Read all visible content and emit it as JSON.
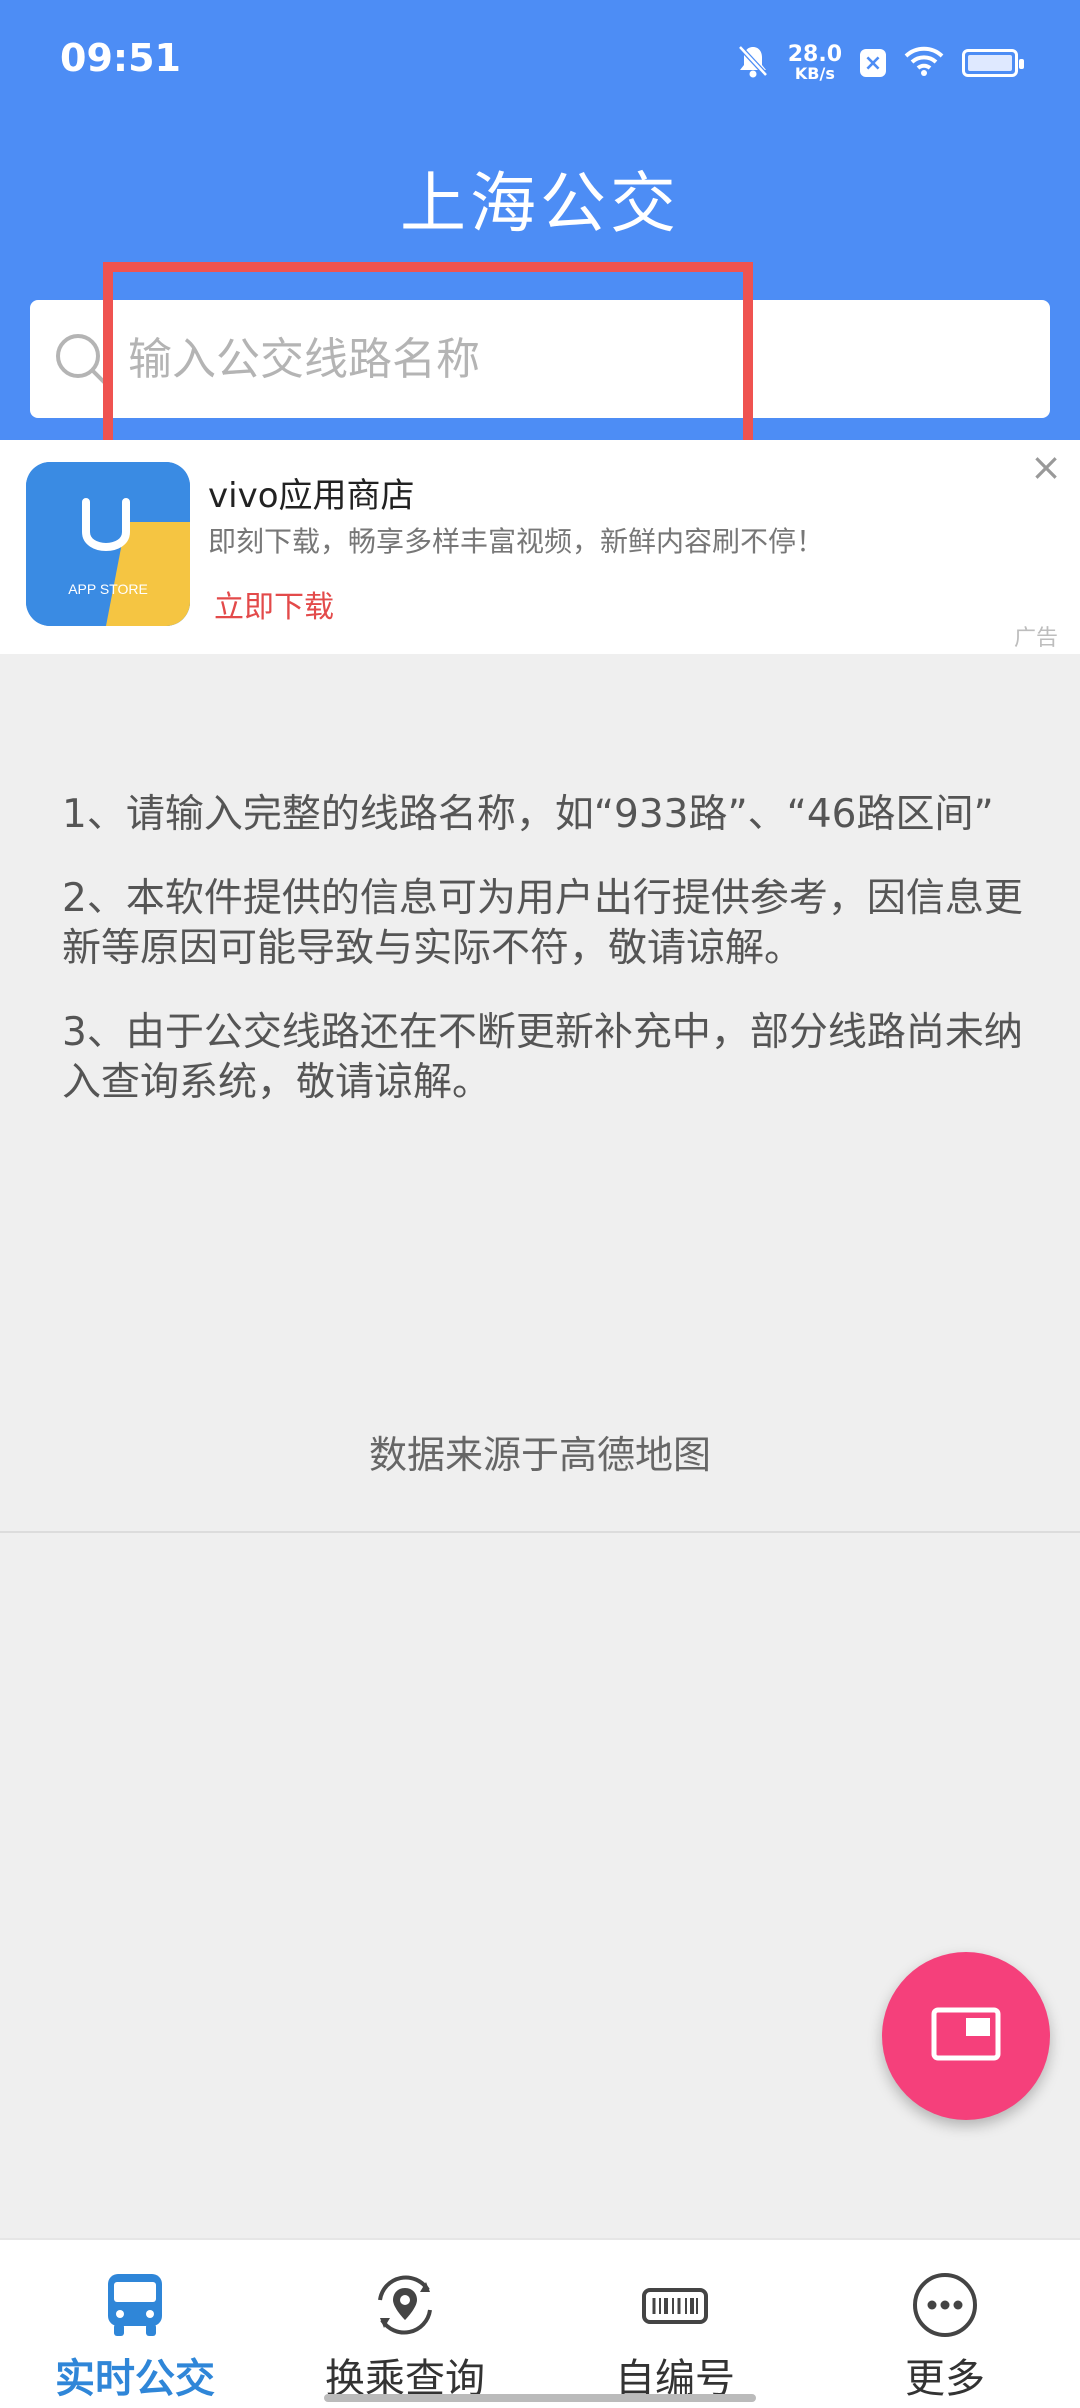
{
  "status_bar": {
    "time": "09:51",
    "speed_value": "28.0",
    "speed_unit": "KB/s",
    "icons": [
      "mute-bell-icon",
      "x-badge-icon",
      "wifi-icon",
      "battery-icon"
    ]
  },
  "header": {
    "title": "上海公交",
    "background_color": "#4d8df5"
  },
  "search": {
    "placeholder": "输入公交线路名称",
    "value": "",
    "icon": "search-icon"
  },
  "ad": {
    "icon_text": "APP STORE",
    "title": "vivo应用商店",
    "description": "即刻下载，畅享多样丰富视频，新鲜内容刷不停！",
    "cta": "立即下载",
    "close": "×",
    "label": "广告"
  },
  "notes": [
    "1、请输入完整的线路名称，如“933路”、“46路区间”",
    "2、本软件提供的信息可为用户出行提供参考，因信息更新等原因可能导致与实际不符，敬请谅解。",
    "3、由于公交线路还在不断更新补充中，部分线路尚未纳入查询系统，敬请谅解。"
  ],
  "source_text": "数据来源于高德地图",
  "fab": {
    "icon": "picture-in-picture-icon",
    "color": "#f5407b"
  },
  "bottom_nav": [
    {
      "label": "实时公交",
      "icon": "bus-icon",
      "active": true
    },
    {
      "label": "换乘查询",
      "icon": "transfer-location-icon",
      "active": false
    },
    {
      "label": "自编号",
      "icon": "barcode-icon",
      "active": false
    },
    {
      "label": "更多",
      "icon": "more-icon",
      "active": false
    }
  ]
}
